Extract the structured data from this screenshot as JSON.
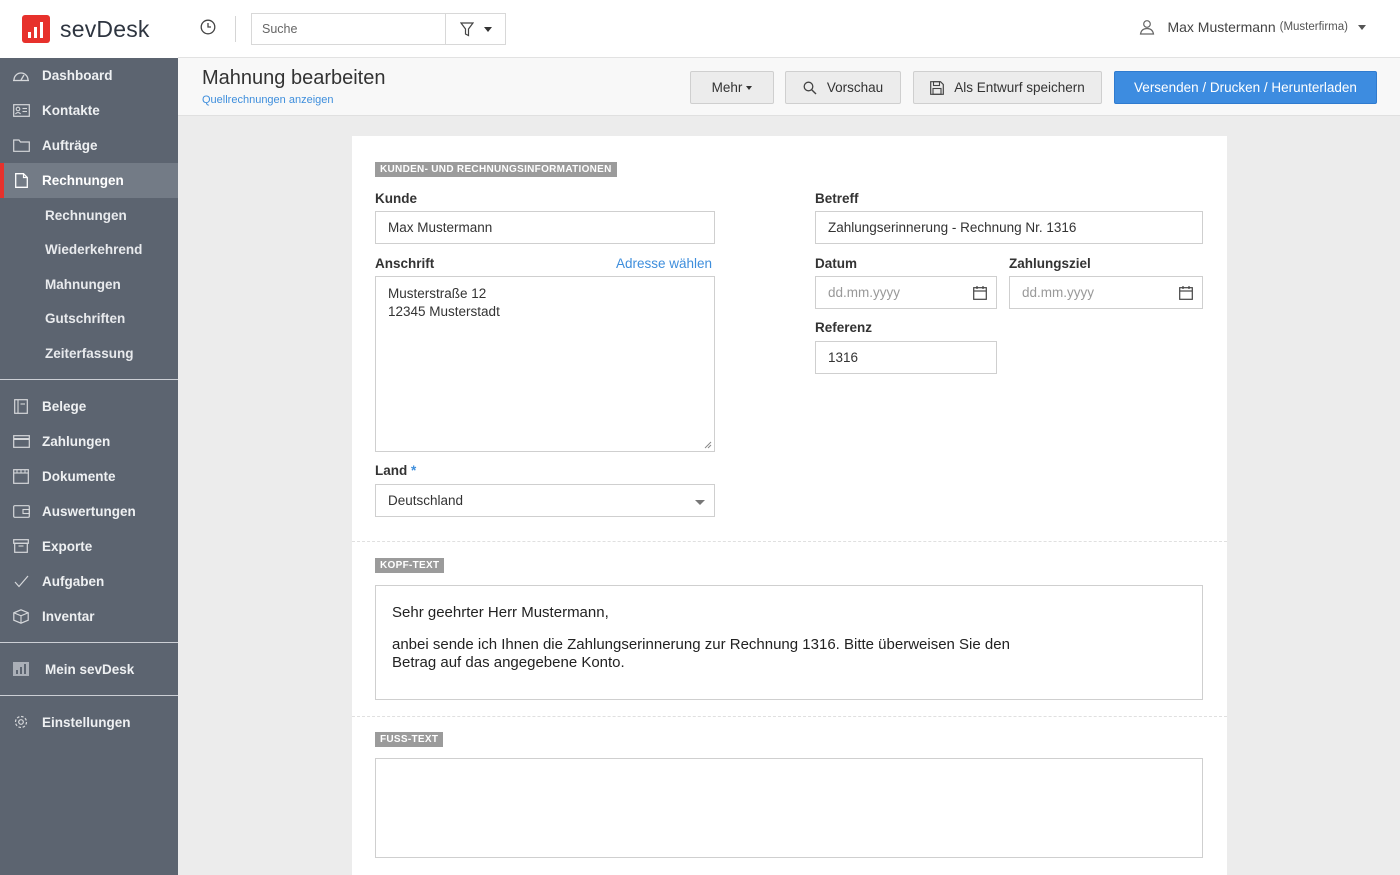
{
  "app": {
    "name": "sevDesk"
  },
  "sidebar": {
    "items": [
      {
        "label": "Dashboard"
      },
      {
        "label": "Kontakte"
      },
      {
        "label": "Aufträge"
      },
      {
        "label": "Rechnungen"
      }
    ],
    "subitems": [
      {
        "label": "Rechnungen"
      },
      {
        "label": "Wiederkehrend"
      },
      {
        "label": "Mahnungen"
      },
      {
        "label": "Gutschriften"
      },
      {
        "label": "Zeiterfassung"
      }
    ],
    "items2": [
      {
        "label": "Belege"
      },
      {
        "label": "Zahlungen"
      },
      {
        "label": "Dokumente"
      },
      {
        "label": "Auswertungen"
      },
      {
        "label": "Exporte"
      },
      {
        "label": "Aufgaben"
      },
      {
        "label": "Inventar"
      }
    ],
    "mein": "Mein sevDesk",
    "settings": "Einstellungen"
  },
  "topbar": {
    "search_placeholder": "Suche",
    "user_name": "Max Mustermann",
    "user_firm": "(Musterfirma)"
  },
  "header": {
    "title": "Mahnung bearbeiten",
    "subtitle": "Quellrechnungen anzeigen",
    "btn_mehr": "Mehr",
    "btn_vorschau": "Vorschau",
    "btn_entwurf": "Als Entwurf speichern",
    "btn_send": "Versenden / Drucken / Herunterladen"
  },
  "form": {
    "section_title": "KUNDEN- UND RECHNUNGSINFORMATIONEN",
    "kunde_label": "Kunde",
    "kunde_value": "Max Mustermann",
    "anschrift_label": "Anschrift",
    "adresse_link": "Adresse wählen",
    "anschrift_line1": "Musterstraße 12",
    "anschrift_line2": "12345 Musterstadt",
    "land_label": "Land",
    "land_required": "*",
    "land_value": "Deutschland",
    "betreff_label": "Betreff",
    "betreff_value": "Zahlungserinnerung - Rechnung Nr. 1316",
    "datum_label": "Datum",
    "datum_placeholder": "dd.mm.yyyy",
    "ziel_label": "Zahlungsziel",
    "ziel_placeholder": "dd.mm.yyyy",
    "referenz_label": "Referenz",
    "referenz_value": "1316"
  },
  "kopf": {
    "section_title": "KOPF-TEXT",
    "line1": "Sehr geehrter Herr Mustermann,",
    "line2": "anbei sende ich Ihnen die Zahlungserinnerung zur Rechnung 1316. Bitte überweisen Sie den",
    "line3": "Betrag auf das angegebene Konto."
  },
  "fuss": {
    "section_title": "FUSS-TEXT"
  },
  "colors": {
    "sidebar": "#5c6470",
    "accent_red": "#e7312c",
    "primary_blue": "#3d8ce0"
  }
}
